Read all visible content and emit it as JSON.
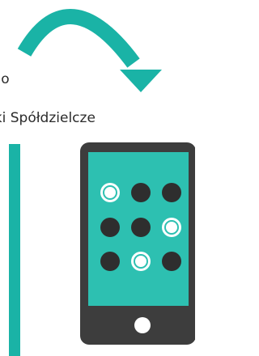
{
  "captions": {
    "line1": "ego",
    "line2": "nki Spółdzielcze"
  },
  "colors": {
    "accent": "#1ab3a6",
    "screen": "#2dc0b1",
    "phone_body": "#3d3d3d",
    "dot_dark": "#2e2e2e",
    "dot_light": "#ffffff",
    "text": "#2b2b2b"
  },
  "icons": {
    "arrow": "curved-arrow-icon",
    "phone": "phone-icon",
    "home_button": "home-button-icon"
  },
  "pattern_grid": {
    "rows": 3,
    "cols": 3,
    "selected": [
      [
        true,
        false,
        false
      ],
      [
        false,
        false,
        true
      ],
      [
        false,
        true,
        false
      ]
    ]
  }
}
